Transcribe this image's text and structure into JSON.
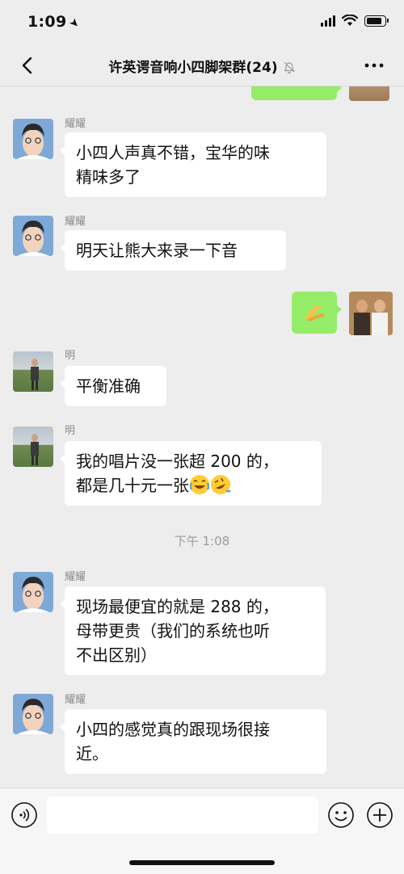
{
  "status_bar": {
    "time": "1:09"
  },
  "nav": {
    "title": "许英谔音响小四脚架群(24)"
  },
  "messages": [
    {
      "sender": "耀耀",
      "text_line1": "小四人声真不错，宝华的味",
      "text_line2": "精味多了"
    },
    {
      "sender": "耀耀",
      "text": "明天让熊大来录一下音"
    },
    {
      "sender": "明",
      "text": "平衡准确"
    },
    {
      "sender": "明",
      "text_line1": "我的唱片没一张超 200 的，",
      "text_line2": "都是几十元一张"
    },
    {
      "sender": "耀耀",
      "text_line1": "现场最便宜的就是 288 的，",
      "text_line2": "母带更贵（我们的系统也听",
      "text_line3": "不出区别）"
    },
    {
      "sender": "耀耀",
      "text_line1": "小四的感觉真的跟现场很接",
      "text_line2": "近。"
    }
  ],
  "time_divider": "下午 1:08",
  "input": {
    "value": ""
  },
  "colors": {
    "background": "#ededed",
    "outgoing_bubble": "#95ec69",
    "incoming_bubble": "#ffffff"
  },
  "icons": [
    "back-icon",
    "mute-bell-icon",
    "more-icon",
    "voice-icon",
    "emoji-icon",
    "plus-icon",
    "clap-emoji",
    "laughing-emoji",
    "rofl-emoji"
  ]
}
